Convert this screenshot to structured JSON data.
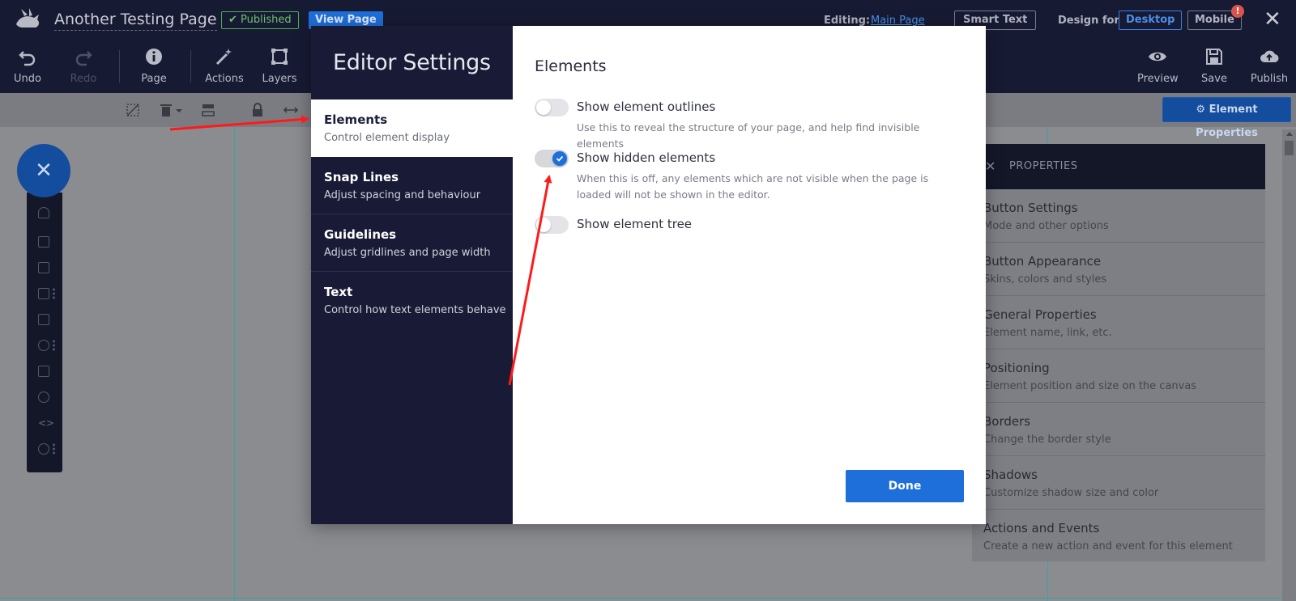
{
  "header": {
    "page_name": "Another Testing Page",
    "published_label": "✔ Published",
    "view_page_label": "View Page",
    "editing_label": "Editing:",
    "editing_target": "Main Page",
    "smart_text_label": "Smart Text",
    "design_for_label": "Design for",
    "desktop_label": "Desktop",
    "mobile_label": "Mobile",
    "mobile_badge": "!",
    "close_symbol": "✕"
  },
  "toolbar": {
    "undo": "Undo",
    "redo": "Redo",
    "page": "Page",
    "actions": "Actions",
    "layers": "Layers",
    "preview": "Preview",
    "save": "Save",
    "publish": "Publish"
  },
  "subbar": {
    "element_properties_label": "⚙ Element Properties"
  },
  "fab": {
    "symbol": "✕"
  },
  "properties": {
    "close_symbol": "✕",
    "title": "PROPERTIES",
    "items": [
      {
        "title": "Button Settings",
        "subtitle": "Mode and other options"
      },
      {
        "title": "Button Appearance",
        "subtitle": "Skins, colors and styles"
      },
      {
        "title": "General Properties",
        "subtitle": "Element name, link, etc."
      },
      {
        "title": "Positioning",
        "subtitle": "Element position and size on the canvas"
      },
      {
        "title": "Borders",
        "subtitle": "Change the border style"
      },
      {
        "title": "Shadows",
        "subtitle": "Customize shadow size and color"
      },
      {
        "title": "Actions and Events",
        "subtitle": "Create a new action and event for this element"
      }
    ]
  },
  "modal": {
    "title": "Editor Settings",
    "nav": [
      {
        "label": "Elements",
        "sub": "Control element display"
      },
      {
        "label": "Snap Lines",
        "sub": "Adjust spacing and behaviour"
      },
      {
        "label": "Guidelines",
        "sub": "Adjust gridlines and page width"
      },
      {
        "label": "Text",
        "sub": "Control how text elements behave"
      }
    ],
    "heading": "Elements",
    "options": [
      {
        "label": "Show element outlines",
        "desc": "Use this to reveal the structure of your page, and help find invisible elements",
        "on": false
      },
      {
        "label": "Show hidden elements",
        "desc": "When this is off, any elements which are not visible when the page is loaded will not be shown in the editor.",
        "on": true
      },
      {
        "label": "Show element tree",
        "desc": "",
        "on": false
      }
    ],
    "done_label": "Done"
  },
  "colors": {
    "header_bg": "#171a33",
    "accent_blue": "#1e6fd9",
    "annotation_red": "#ff1a1a"
  }
}
